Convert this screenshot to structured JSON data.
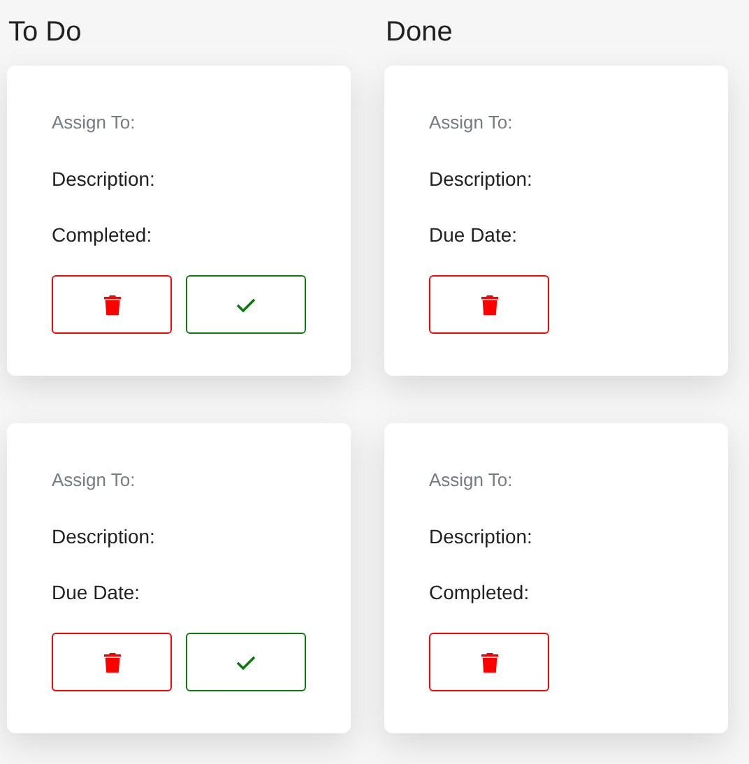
{
  "columns": [
    {
      "title": "To Do",
      "cards": [
        {
          "fields": [
            "Assign To:",
            "Description:",
            "Completed:"
          ],
          "buttons": [
            {
              "kind": "delete"
            },
            {
              "kind": "complete"
            }
          ]
        },
        {
          "fields": [
            "Assign To:",
            "Description:",
            "Due Date:"
          ],
          "buttons": [
            {
              "kind": "delete"
            },
            {
              "kind": "complete"
            }
          ]
        }
      ]
    },
    {
      "title": "Done",
      "cards": [
        {
          "fields": [
            "Assign To:",
            "Description:",
            "Due Date:"
          ],
          "buttons": [
            {
              "kind": "delete"
            }
          ]
        },
        {
          "fields": [
            "Assign To:",
            "Description:",
            "Completed:"
          ],
          "buttons": [
            {
              "kind": "delete"
            }
          ]
        }
      ]
    }
  ]
}
